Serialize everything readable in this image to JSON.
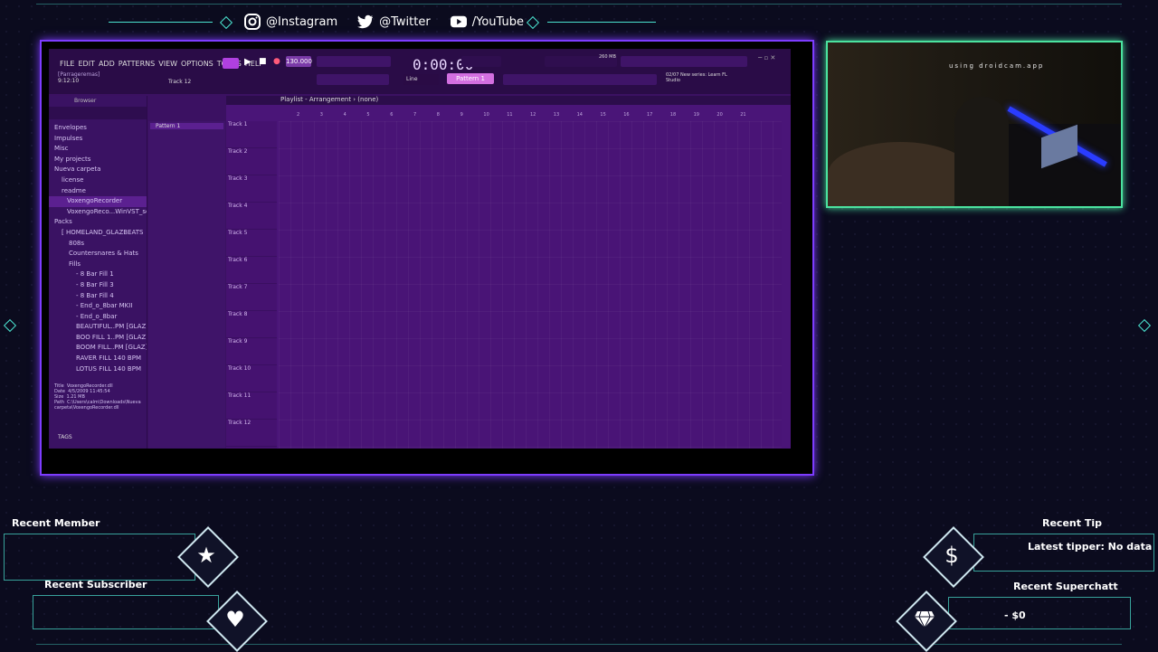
{
  "social": {
    "instagram": "@Instagram",
    "twitter": "@Twitter",
    "youtube": "/YouTube"
  },
  "fl": {
    "menu": [
      "FILE",
      "EDIT",
      "ADD",
      "PATTERNS",
      "VIEW",
      "OPTIONS",
      "TOOLS",
      "HELP"
    ],
    "project": "[Parrageremas]",
    "clock": "9:12:10",
    "hint_track": "Track 12",
    "tempo": "130.000",
    "time": "0:00:00",
    "memory": "260 MB",
    "pattern": "Pattern 1",
    "line_mode": "Line",
    "news": "02/07 New series: Learn FL Studio",
    "playlist_title": "Playlist - Arrangement › (none)",
    "browser_title": "Browser",
    "pattern_item": "Pattern 1",
    "browser_items": [
      "Envelopes",
      "Impulses",
      "Misc",
      "My projects",
      "Nueva carpeta",
      "license",
      "readme",
      "VoxengoRecorder",
      "VoxengoReco...WinVST_setup",
      "Packs",
      "[ HOMELAND_GLAZBEATS",
      "808s",
      "Countersnares & Hats",
      "Fills",
      "- 8 Bar Fill 1",
      "- 8 Bar Fill 3",
      "- 8 Bar Fill 4",
      "- End_o_8bar MKII",
      "- End_o_8bar",
      "BEAUTIFUL..PM [GLAZ]",
      "BOO FILL 1..PM [GLAZ]",
      "BOOM FILL..PM [GLAZ]",
      "RAVER FILL 140 BPM",
      "LOTUS FILL 140 BPM"
    ],
    "info": {
      "title_k": "Title",
      "title_v": "VoxengoRecorder.dll",
      "date_k": "Date",
      "date_v": "4/5/2009 11:45:54",
      "size_k": "Size",
      "size_v": "1.21 MB",
      "path_k": "Path",
      "path_v": "C:\\Users\\calm\\Downloads\\Nueva carpeta\\VoxengoRecorder.dll"
    },
    "tags": "TAGS",
    "tracks": [
      "Track 1",
      "Track 2",
      "Track 3",
      "Track 4",
      "Track 5",
      "Track 6",
      "Track 7",
      "Track 8",
      "Track 9",
      "Track 10",
      "Track 11",
      "Track 12"
    ],
    "ruler": [
      "2",
      "3",
      "4",
      "5",
      "6",
      "7",
      "8",
      "9",
      "10",
      "11",
      "12",
      "13",
      "14",
      "15",
      "16",
      "17",
      "18",
      "19",
      "20",
      "21"
    ]
  },
  "cam": {
    "watermark": "using droidcam.app"
  },
  "alerts": {
    "recent_member": "Recent Member",
    "recent_subscriber": "Recent Subscriber",
    "recent_tip": "Recent Tip",
    "latest_tipper": "Latest tipper: No data",
    "recent_superchat": "Recent Superchatt",
    "superchat_value": "- $0"
  },
  "colors": {
    "accent_teal": "#4be3d0",
    "frame_purple": "#7d3cff",
    "cam_green": "#4be3a0",
    "fl_bg": "#3b1162"
  }
}
